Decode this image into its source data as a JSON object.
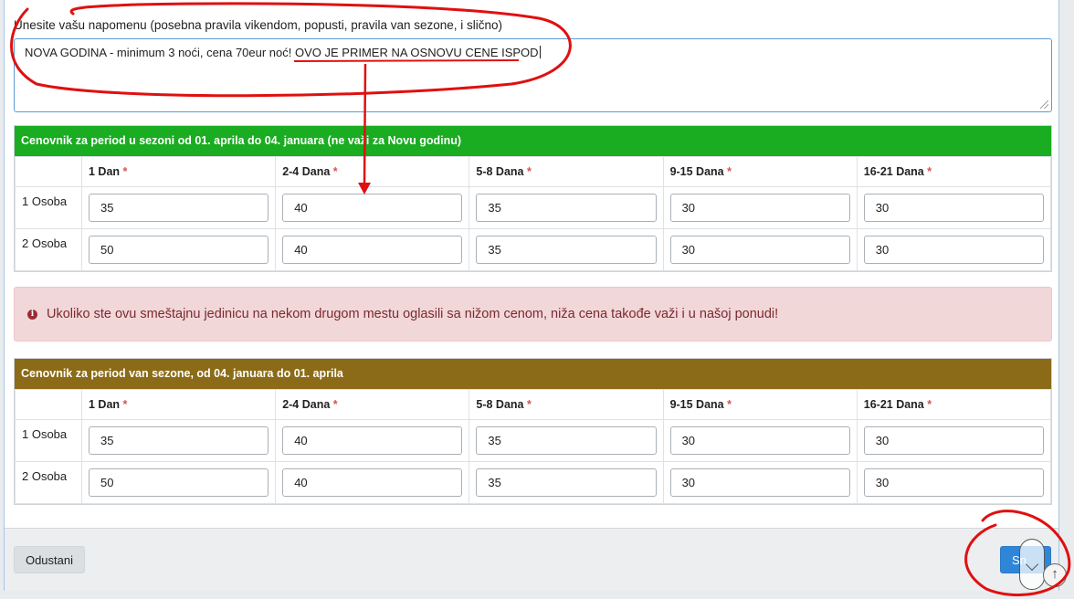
{
  "note": {
    "label": "Unesite vašu napomenu (posebna pravila vikendom, popusti, pravila van sezone, i slično)",
    "value_part1": "NOVA GODINA - minimum 3 noći, cena 70eur noć!  ",
    "value_part2": "OVO JE PRIMER NA OSNOVU CENE ISPOD"
  },
  "in_season": {
    "title_prefix": "Cenovnik za period ",
    "title_bold": "u sezoni",
    "title_suffix": " od 01. aprila do 04. januara (ne važi za Novu godinu)",
    "header_color": "#1aac21",
    "columns": [
      "1 Dan",
      "2-4 Dana",
      "5-8 Dana",
      "9-15 Dana",
      "16-21 Dana"
    ],
    "required_mark": "*",
    "rows": [
      {
        "label": "1 Osoba",
        "values": [
          "35",
          "40",
          "35",
          "30",
          "30"
        ]
      },
      {
        "label": "2 Osoba",
        "values": [
          "50",
          "40",
          "35",
          "30",
          "30"
        ]
      }
    ]
  },
  "alert": {
    "text": "Ukoliko ste ovu smeštajnu jedinicu na nekom drugom mestu oglasili sa nižom cenom, niža cena takođe važi i u našoj ponudi!",
    "icon": "info-circle-icon"
  },
  "off_season": {
    "title": "Cenovnik za period van sezone, od 04. januara do 01. aprila",
    "header_color": "#8b6b17",
    "columns": [
      "1 Dan",
      "2-4 Dana",
      "5-8 Dana",
      "9-15 Dana",
      "16-21 Dana"
    ],
    "required_mark": "*",
    "rows": [
      {
        "label": "1 Osoba",
        "values": [
          "35",
          "40",
          "35",
          "30",
          "30"
        ]
      },
      {
        "label": "2 Osoba",
        "values": [
          "50",
          "40",
          "35",
          "30",
          "30"
        ]
      }
    ]
  },
  "footer": {
    "cancel_label": "Odustani",
    "save_label": "Sn"
  },
  "annotation_color": "#e01010"
}
